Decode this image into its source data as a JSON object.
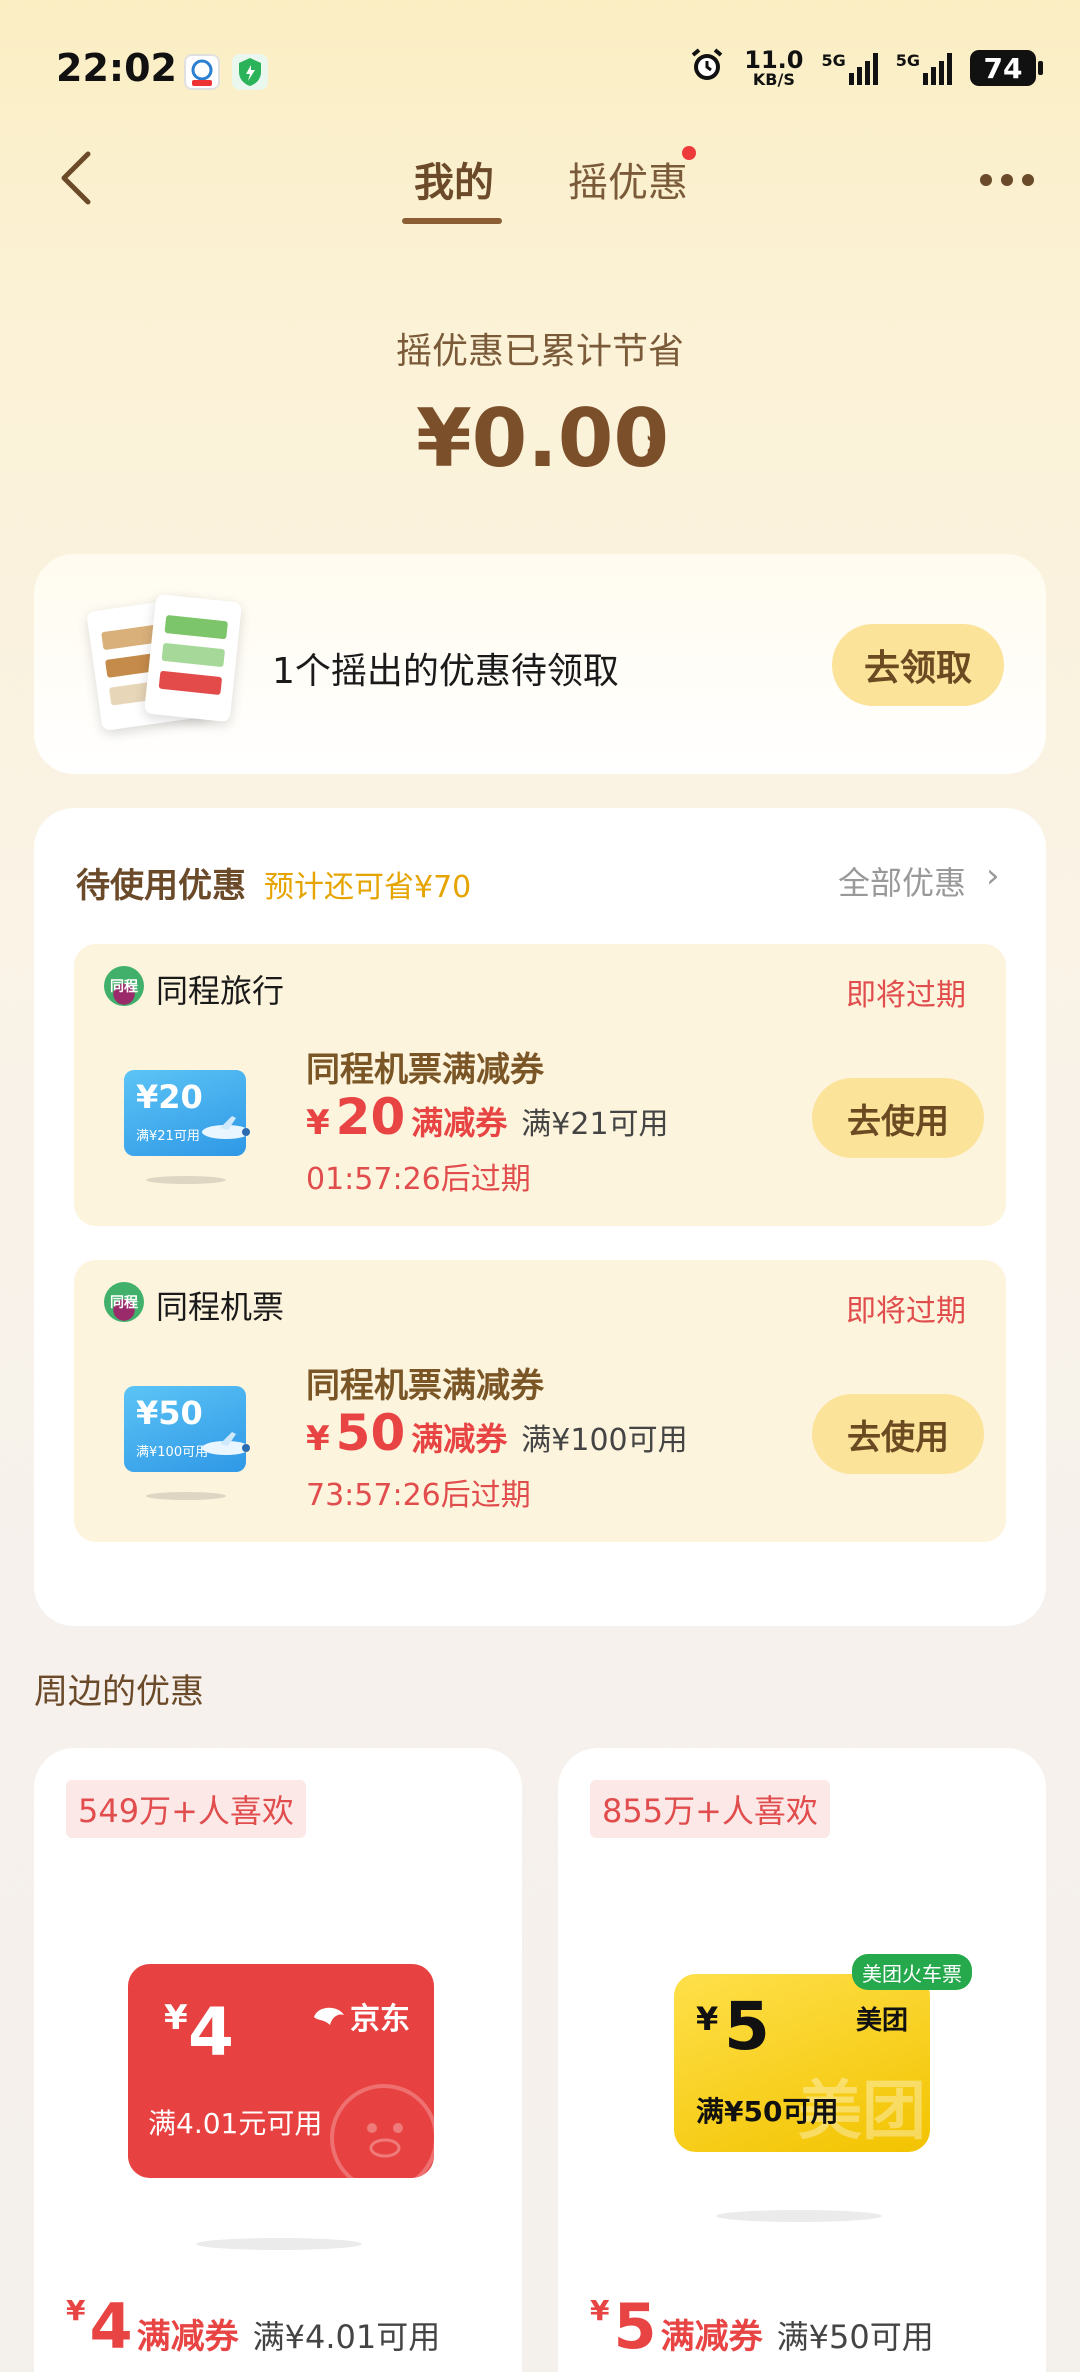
{
  "status_bar": {
    "time": "22:02",
    "net_speed": "11.0",
    "net_unit": "KB/S",
    "sig1_label": "5G",
    "sig2_label": "5G",
    "battery": "74"
  },
  "header": {
    "tabs": [
      {
        "label": "我的",
        "active": true
      },
      {
        "label": "摇优惠",
        "active": false,
        "has_dot": true
      }
    ]
  },
  "savings": {
    "label": "摇优惠已累计节省",
    "amount": "¥0.00"
  },
  "pending": {
    "text": "1个摇出的优惠待领取",
    "button": "去领取"
  },
  "unused": {
    "title": "待使用优惠",
    "subtitle": "预计还可省¥70",
    "all_link": "全部优惠",
    "coupons": [
      {
        "brand": "同程旅行",
        "logo_text": "同程",
        "status": "即将过期",
        "ticket_amount": "¥20",
        "ticket_condition": "满¥21可用",
        "title": "同程机票满减券",
        "yen": "¥",
        "amount": "20",
        "type": "满减券",
        "condition": "满¥21可用",
        "expires": "01:57:26后过期",
        "button": "去使用"
      },
      {
        "brand": "同程机票",
        "logo_text": "同程",
        "status": "即将过期",
        "ticket_amount": "¥50",
        "ticket_condition": "满¥100可用",
        "title": "同程机票满减券",
        "yen": "¥",
        "amount": "50",
        "type": "满减券",
        "condition": "满¥100可用",
        "expires": "73:57:26后过期",
        "button": "去使用"
      }
    ]
  },
  "nearby": {
    "title": "周边的优惠",
    "items": [
      {
        "likes": "549万+人喜欢",
        "ticket_yen": "¥",
        "ticket_amount": "4",
        "ticket_brand": "京东",
        "ticket_condition": "满4.01元可用",
        "yen": "¥",
        "amount": "4",
        "type": "满减券",
        "condition": "满¥4.01可用",
        "accent": "#e84141"
      },
      {
        "likes": "855万+人喜欢",
        "tag": "美团火车票",
        "ticket_yen": "¥",
        "ticket_amount": "5",
        "ticket_brand": "美团",
        "ticket_condition": "满¥50可用",
        "watermark": "美团",
        "yen": "¥",
        "amount": "5",
        "type": "满减券",
        "condition": "满¥50可用",
        "accent": "#f5c400"
      }
    ]
  }
}
